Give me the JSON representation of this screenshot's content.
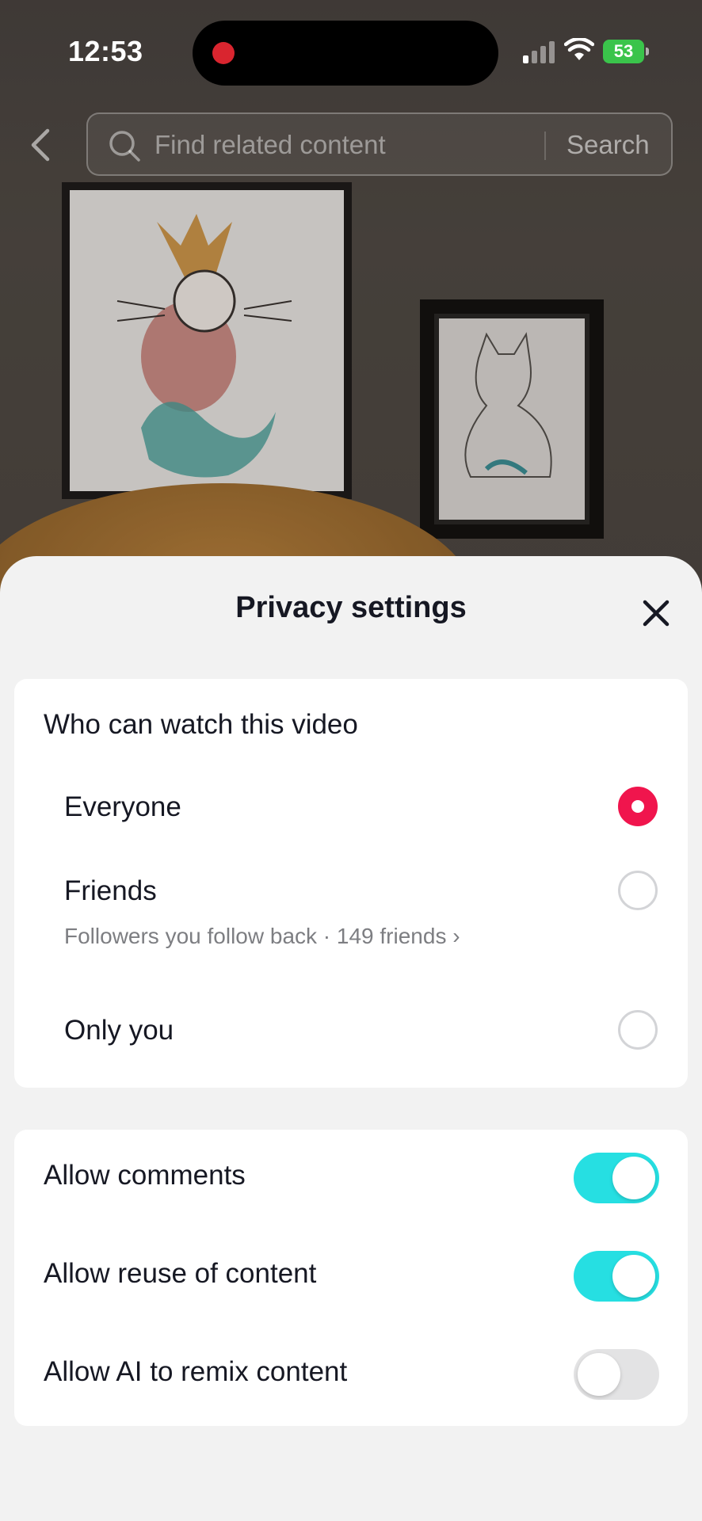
{
  "status_bar": {
    "time": "12:53",
    "battery": "53"
  },
  "search": {
    "placeholder": "Find related content",
    "button_label": "Search"
  },
  "sheet": {
    "title": "Privacy settings",
    "visibility": {
      "title": "Who can watch this video",
      "options": [
        {
          "label": "Everyone",
          "selected": true
        },
        {
          "label": "Friends",
          "sublabel": "Followers you follow back · 149 friends ›",
          "selected": false
        },
        {
          "label": "Only you",
          "selected": false
        }
      ]
    },
    "toggles": [
      {
        "label": "Allow comments",
        "on": true
      },
      {
        "label": "Allow reuse of content",
        "on": true
      },
      {
        "label": "Allow AI to remix content",
        "on": false
      }
    ]
  },
  "colors": {
    "accent_red": "#f0154d",
    "toggle_on": "#26dfe2",
    "toggle_off": "#e3e3e4",
    "battery_green": "#3ac44b"
  },
  "icons": [
    "back-chevron-icon",
    "search-icon",
    "close-icon",
    "signal-icon",
    "wifi-icon",
    "battery-icon"
  ]
}
